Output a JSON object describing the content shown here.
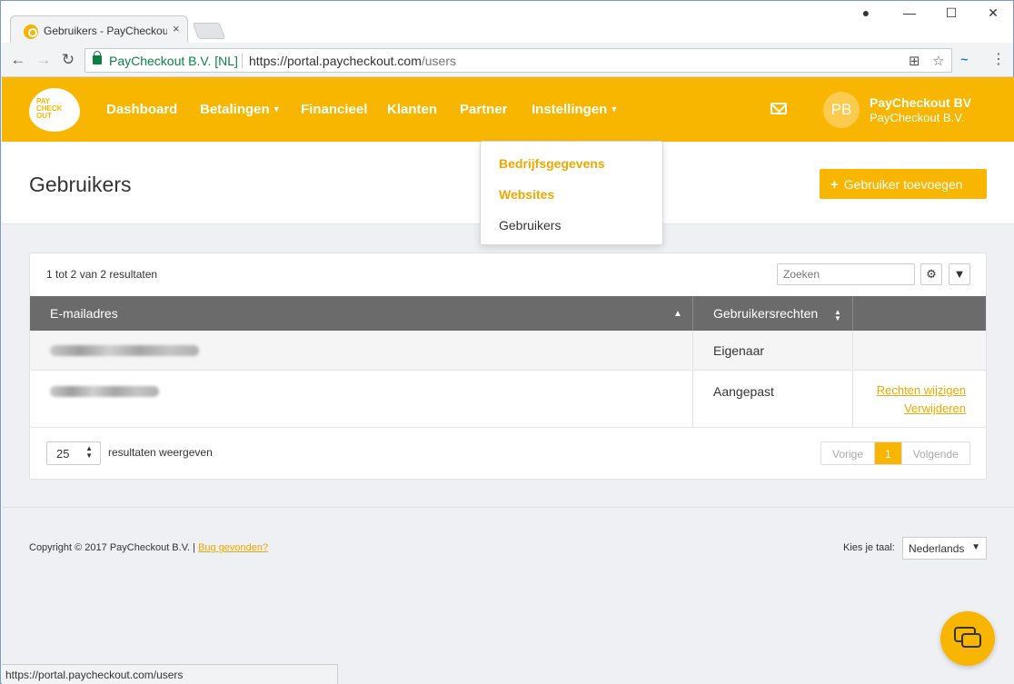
{
  "browser": {
    "tab_title": "Gebruikers - PayCheckout",
    "tab_close": "×",
    "controls": {
      "account": "●",
      "minimize": "—",
      "maximize": "☐",
      "close": "✕"
    },
    "secure_label": "PayCheckout B.V. [NL]",
    "url_host": "https://portal.paycheckout.com",
    "url_path": "/users",
    "status_url": "https://portal.paycheckout.com/users"
  },
  "logo": {
    "line1": "PAY",
    "line2": "CHECK",
    "line3": "OUT"
  },
  "nav": {
    "items": [
      "Dashboard",
      "Betalingen",
      "Financieel",
      "Klanten",
      "Partner",
      "Instellingen"
    ]
  },
  "account": {
    "initials": "PB",
    "name": "PayCheckout BV",
    "company": "PayCheckout B.V."
  },
  "dropdown": {
    "items": [
      "Bedrijfsgegevens",
      "Websites",
      "Gebruikers"
    ]
  },
  "page": {
    "title": "Gebruikers",
    "add_button": "Gebruiker toevoegen"
  },
  "table": {
    "result_count": "1 tot 2 van 2 resultaten",
    "search_placeholder": "Zoeken",
    "headers": [
      "E-mailadres",
      "Gebruikersrechten"
    ],
    "rows": [
      {
        "rights": "Eigenaar"
      },
      {
        "rights": "Aangepast",
        "action1": "Rechten wijzigen",
        "action2": "Verwijderen"
      }
    ],
    "page_size": "25",
    "page_size_label": "resultaten weergeven",
    "pager": {
      "prev": "Vorige",
      "current": "1",
      "next": "Volgende"
    }
  },
  "footer": {
    "copyright": "Copyright © 2017 PayCheckout B.V. |",
    "bug_link": "Bug gevonden?",
    "lang_label": "Kies je taal:",
    "lang_value": "Nederlands"
  },
  "colors": {
    "brand": "#f9b600",
    "header_dark": "#6b6b6b",
    "link": "#f0a800"
  }
}
